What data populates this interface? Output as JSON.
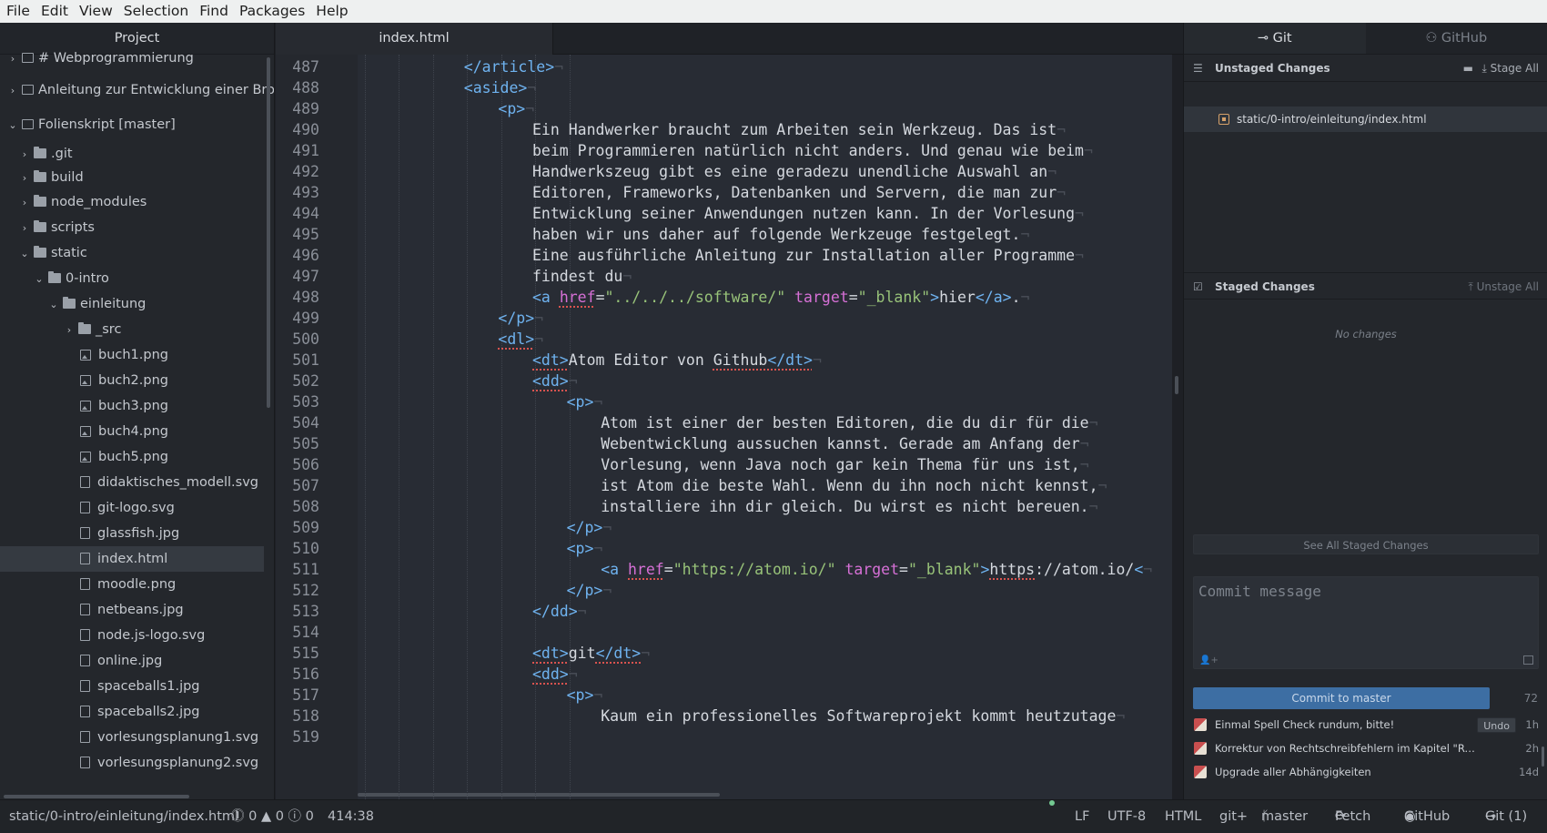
{
  "menu": [
    "File",
    "Edit",
    "View",
    "Selection",
    "Find",
    "Packages",
    "Help"
  ],
  "tree": {
    "header": "Project",
    "items": [
      {
        "label": "# Webprogrammierung",
        "type": "repo",
        "chevron": "›"
      },
      {
        "label": "Anleitung zur Entwicklung einer Browse",
        "type": "repo",
        "chevron": "›"
      },
      {
        "label": "Folienskript  [master]",
        "type": "repo",
        "chevron": "⌄"
      },
      {
        "label": ".git",
        "type": "folder",
        "chevron": "›"
      },
      {
        "label": "build",
        "type": "folder",
        "chevron": "›"
      },
      {
        "label": "node_modules",
        "type": "folder",
        "chevron": "›"
      },
      {
        "label": "scripts",
        "type": "folder",
        "chevron": "›"
      },
      {
        "label": "static",
        "type": "folder",
        "chevron": "⌄"
      },
      {
        "label": "0-intro",
        "type": "folder",
        "chevron": "⌄"
      },
      {
        "label": "einleitung",
        "type": "folder",
        "chevron": "⌄"
      },
      {
        "label": "_src",
        "type": "folder",
        "chevron": "›"
      },
      {
        "label": "buch1.png",
        "type": "image"
      },
      {
        "label": "buch2.png",
        "type": "image"
      },
      {
        "label": "buch3.png",
        "type": "image"
      },
      {
        "label": "buch4.png",
        "type": "image"
      },
      {
        "label": "buch5.png",
        "type": "image"
      },
      {
        "label": "didaktisches_modell.svg",
        "type": "file"
      },
      {
        "label": "git-logo.svg",
        "type": "file"
      },
      {
        "label": "glassfish.jpg",
        "type": "file"
      },
      {
        "label": "index.html",
        "type": "file",
        "selected": true
      },
      {
        "label": "moodle.png",
        "type": "file"
      },
      {
        "label": "netbeans.jpg",
        "type": "file"
      },
      {
        "label": "node.js-logo.svg",
        "type": "file"
      },
      {
        "label": "online.jpg",
        "type": "file"
      },
      {
        "label": "spaceballs1.jpg",
        "type": "file"
      },
      {
        "label": "spaceballs2.jpg",
        "type": "file"
      },
      {
        "label": "vorlesungsplanung1.svg",
        "type": "file"
      },
      {
        "label": "vorlesungsplanung2.svg",
        "type": "file"
      }
    ]
  },
  "editor": {
    "tab": "index.html",
    "lines": [
      {
        "n": "487",
        "guides": 3,
        "parts": [
          [
            "tag",
            "</article>"
          ]
        ]
      },
      {
        "n": "488",
        "guides": 3,
        "parts": [
          [
            "tag",
            "<aside>"
          ]
        ]
      },
      {
        "n": "489",
        "guides": 4,
        "parts": [
          [
            "tag",
            "<p>"
          ]
        ]
      },
      {
        "n": "490",
        "guides": 5,
        "parts": [
          [
            "txt",
            "Ein Handwerker braucht zum Arbeiten sein Werkzeug. Das ist"
          ]
        ]
      },
      {
        "n": "491",
        "guides": 5,
        "parts": [
          [
            "txt",
            "beim Programmieren natürlich nicht anders. Und genau wie beim"
          ]
        ]
      },
      {
        "n": "492",
        "guides": 5,
        "parts": [
          [
            "txt",
            "Handwerkszeug gibt es eine geradezu unendliche Auswahl an"
          ]
        ]
      },
      {
        "n": "493",
        "guides": 5,
        "parts": [
          [
            "txt",
            "Editoren, Frameworks, Datenbanken und Servern, die man zur"
          ]
        ]
      },
      {
        "n": "494",
        "guides": 5,
        "parts": [
          [
            "txt",
            "Entwicklung seiner Anwendungen nutzen kann. In der Vorlesung"
          ]
        ]
      },
      {
        "n": "495",
        "guides": 5,
        "parts": [
          [
            "txt",
            "haben wir uns daher auf folgende Werkzeuge festgelegt."
          ]
        ]
      },
      {
        "n": "496",
        "guides": 5,
        "parts": [
          [
            "txt",
            "Eine ausführliche Anleitung zur Installation aller Programme"
          ]
        ]
      },
      {
        "n": "497",
        "guides": 5,
        "parts": [
          [
            "txt",
            "findest du"
          ]
        ]
      },
      {
        "n": "498",
        "guides": 5,
        "parts": [
          [
            "tag",
            "<a "
          ],
          [
            "attr-err",
            "href"
          ],
          [
            "txt",
            "="
          ],
          [
            "str",
            "\"../../../software/\""
          ],
          [
            "txt",
            " "
          ],
          [
            "attr",
            "target"
          ],
          [
            "txt",
            "="
          ],
          [
            "str",
            "\"_blank\""
          ],
          [
            "tag",
            ">"
          ],
          [
            "txt",
            "hier"
          ],
          [
            "tag",
            "</a>"
          ],
          [
            "txt",
            "."
          ]
        ]
      },
      {
        "n": "499",
        "guides": 4,
        "parts": [
          [
            "tag",
            "</p>"
          ]
        ]
      },
      {
        "n": "500",
        "guides": 4,
        "parts": [
          [
            "tag-err",
            "<dl>"
          ]
        ]
      },
      {
        "n": "501",
        "guides": 5,
        "parts": [
          [
            "tag-err",
            "<dt>"
          ],
          [
            "txt",
            "Atom Editor von "
          ],
          [
            "txt-err",
            "Github"
          ],
          [
            "tag-err",
            "</dt>"
          ]
        ]
      },
      {
        "n": "502",
        "guides": 5,
        "parts": [
          [
            "tag-err",
            "<dd>"
          ]
        ]
      },
      {
        "n": "503",
        "guides": 6,
        "parts": [
          [
            "tag",
            "<p>"
          ]
        ]
      },
      {
        "n": "504",
        "guides": 7,
        "parts": [
          [
            "txt",
            "Atom ist einer der besten Editoren, die du dir für die"
          ]
        ]
      },
      {
        "n": "505",
        "guides": 7,
        "parts": [
          [
            "txt",
            "Webentwicklung aussuchen kannst. Gerade am Anfang der"
          ]
        ]
      },
      {
        "n": "506",
        "guides": 7,
        "parts": [
          [
            "txt",
            "Vorlesung, wenn Java noch gar kein Thema für uns ist,"
          ]
        ]
      },
      {
        "n": "507",
        "guides": 7,
        "parts": [
          [
            "txt",
            "ist Atom die beste Wahl. Wenn du ihn noch nicht kennst,"
          ]
        ]
      },
      {
        "n": "508",
        "guides": 7,
        "parts": [
          [
            "txt",
            "installiere ihn dir gleich. Du wirst es nicht bereuen."
          ]
        ]
      },
      {
        "n": "509",
        "guides": 6,
        "parts": [
          [
            "tag",
            "</p>"
          ]
        ]
      },
      {
        "n": "510",
        "guides": 6,
        "parts": [
          [
            "tag",
            "<p>"
          ]
        ]
      },
      {
        "n": "511",
        "guides": 7,
        "parts": [
          [
            "tag",
            "<a "
          ],
          [
            "attr-err",
            "href"
          ],
          [
            "txt",
            "="
          ],
          [
            "str",
            "\"https://atom.io/\""
          ],
          [
            "txt",
            " "
          ],
          [
            "attr",
            "target"
          ],
          [
            "txt",
            "="
          ],
          [
            "str",
            "\"_blank\""
          ],
          [
            "tag",
            ">"
          ],
          [
            "txt-err",
            "https"
          ],
          [
            "txt",
            "://atom.io/"
          ],
          [
            "tag",
            "<"
          ]
        ]
      },
      {
        "n": "512",
        "guides": 6,
        "parts": [
          [
            "tag",
            "</p>"
          ]
        ]
      },
      {
        "n": "513",
        "guides": 5,
        "parts": [
          [
            "tag",
            "</dd>"
          ]
        ]
      },
      {
        "n": "514",
        "guides": 0,
        "parts": []
      },
      {
        "n": "515",
        "guides": 5,
        "parts": [
          [
            "tag-err",
            "<dt>"
          ],
          [
            "txt",
            "git"
          ],
          [
            "tag-err",
            "</dt>"
          ]
        ]
      },
      {
        "n": "516",
        "guides": 5,
        "parts": [
          [
            "tag-err",
            "<dd>"
          ]
        ]
      },
      {
        "n": "517",
        "guides": 6,
        "parts": [
          [
            "tag",
            "<p>"
          ]
        ]
      },
      {
        "n": "518",
        "guides": 7,
        "parts": [
          [
            "txt",
            "Kaum ein professionelles Softwareprojekt kommt heutzutage"
          ]
        ]
      },
      {
        "n": "519",
        "guides": 0,
        "parts": []
      }
    ]
  },
  "git": {
    "tab_git": "Git",
    "tab_github": "GitHub",
    "unstaged_title": "Unstaged Changes",
    "stage_all": "Stage All",
    "unstaged_file": "static/0-intro/einleitung/index.html",
    "staged_title": "Staged Changes",
    "unstage_all": "Unstage All",
    "no_changes": "No changes",
    "see_all": "See All Staged Changes",
    "commit_placeholder": "Commit message",
    "commit_button": "Commit to master",
    "char_count": "72",
    "commits": [
      {
        "message": "Einmal Spell Check rundum, bitte!",
        "time": "1h",
        "undo": "Undo"
      },
      {
        "message": "Korrektur von Rechtschreibfehlern im Kapitel \"Responsive ...",
        "time": "2h"
      },
      {
        "message": "Upgrade aller Abhängigkeiten",
        "time": "14d"
      }
    ]
  },
  "status": {
    "path": "static/0-intro/einleitung/index.html",
    "diagnostics": "⓵ 0 ▲ 0 ⓘ 0",
    "cursor": "414:38",
    "line_ending": "LF",
    "encoding": "UTF-8",
    "grammar": "HTML",
    "git_plus": "git+",
    "branch": "master",
    "fetch": "Fetch",
    "github": "GitHub",
    "git": "Git (1)"
  },
  "colors": {
    "accent": "#3d6ea3",
    "tag": "#6fb3f0",
    "attribute": "#d670d6",
    "string": "#98c379",
    "modified": "#d6a16a"
  }
}
